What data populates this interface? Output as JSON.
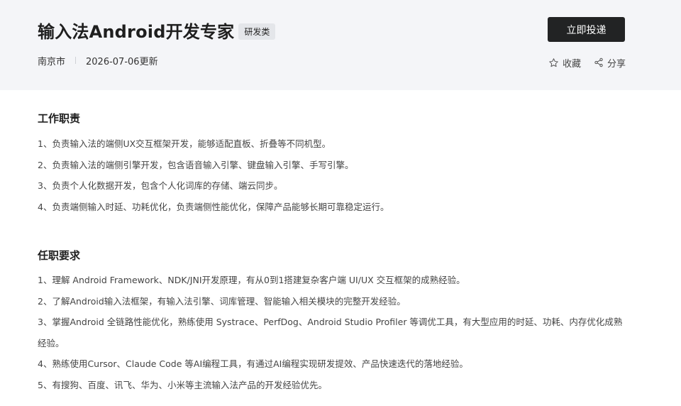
{
  "header": {
    "job_title": "输入法Android开发专家",
    "category": "研发类",
    "location": "南京市",
    "updated": "2026-07-06更新",
    "apply_label": "立即投递",
    "favorite_label": "收藏",
    "share_label": "分享"
  },
  "duties": {
    "title": "工作职责",
    "items": [
      "1、负责输入法的端侧UX交互框架开发，能够适配直板、折叠等不同机型。",
      "2、负责输入法的端侧引擎开发，包含语音输入引擎、键盘输入引擎、手写引擎。",
      "3、负责个人化数据开发，包含个人化词库的存储、端云同步。",
      "4、负责端侧输入时延、功耗优化，负责端侧性能优化，保障产品能够长期可靠稳定运行。"
    ]
  },
  "requirements": {
    "title": "任职要求",
    "items": [
      "1、理解 Android Framework、NDK/JNI开发原理，有从0到1搭建复杂客户端 UI/UX 交互框架的成熟经验。",
      "2、了解Android输入法框架，有输入法引擎、词库管理、智能输入相关模块的完整开发经验。",
      "3、掌握Android 全链路性能优化，熟练使用 Systrace、PerfDog、Android Studio Profiler 等调优工具，有大型应用的时延、功耗、内存优化成熟经验。",
      "4、熟练使用Cursor、Claude Code 等AI编程工具，有通过AI编程实现研发提效、产品快速迭代的落地经验。",
      "5、有搜狗、百度、讯飞、华为、小米等主流输入法产品的开发经验优先。"
    ]
  }
}
